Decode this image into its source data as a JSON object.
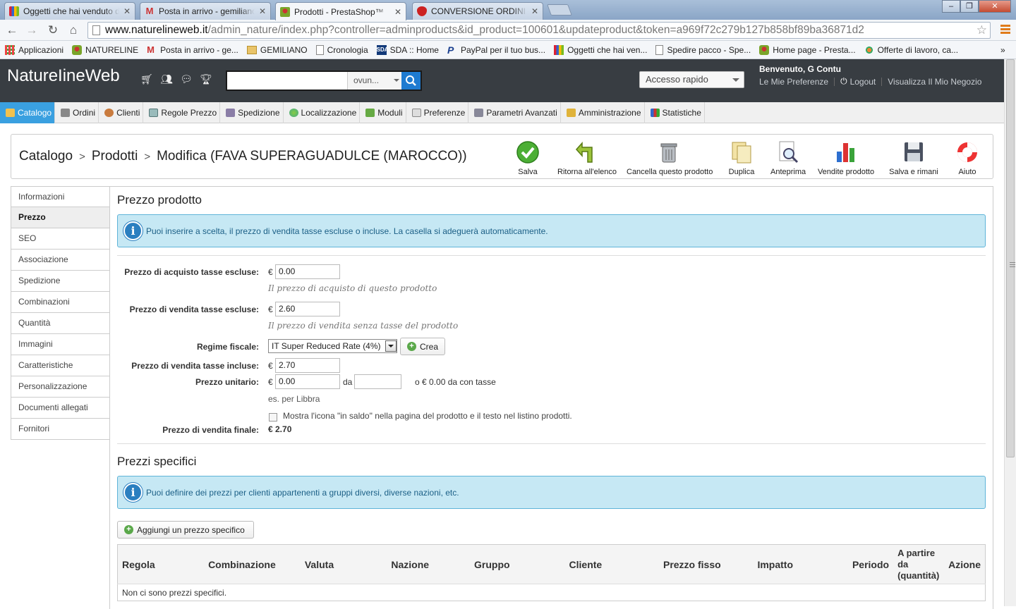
{
  "browser": {
    "tabs": [
      {
        "title": "Oggetti che hai venduto d",
        "icon": "ebay-icon",
        "color": "#d23"
      },
      {
        "title": "Posta in arrivo - gemiliano",
        "icon": "gmail-icon",
        "color": "#c33"
      },
      {
        "title": "Prodotti - PrestaShop™",
        "icon": "prestashop-icon",
        "color": "#7aa52a"
      },
      {
        "title": "CONVERSIONE ORDINI DA",
        "icon": "strawberry-icon",
        "color": "#c22"
      }
    ],
    "url_domain": "www.naturelineweb.it",
    "url_path": "/admin_nature/index.php?controller=adminproducts&id_product=100601&updateproduct&token=a969f72c279b127b858bf89ba36871d2",
    "bookmarks": [
      {
        "label": "Applicazioni",
        "icon": "apps-icon"
      },
      {
        "label": "NATURELINE",
        "icon": "prestashop-icon"
      },
      {
        "label": "Posta in arrivo - ge...",
        "icon": "gmail-icon"
      },
      {
        "label": "GEMILIANO",
        "icon": "folder-icon"
      },
      {
        "label": "Cronologia",
        "icon": "page-icon"
      },
      {
        "label": "SDA :: Home",
        "icon": "sda-icon"
      },
      {
        "label": "PayPal per il tuo bus...",
        "icon": "paypal-icon"
      },
      {
        "label": "Oggetti che hai ven...",
        "icon": "ebay-icon"
      },
      {
        "label": "Spedire pacco - Spe...",
        "icon": "page-icon"
      },
      {
        "label": "Home page - Presta...",
        "icon": "prestashop-icon"
      },
      {
        "label": "Offerte di lavoro, ca...",
        "icon": "jobs-icon"
      }
    ],
    "more": "»"
  },
  "header": {
    "brand": "NatureIineWeb",
    "search_placeholder": "",
    "search_scope": "ovun...",
    "quick_access": "Accesso rapido",
    "welcome": "Benvenuto, G Contu",
    "preferences": "Le Mie Preferenze",
    "logout": "Logout",
    "view_shop": "Visualizza Il Mio Negozio"
  },
  "menu": [
    {
      "label": "Catalogo",
      "icon": "folder-icon",
      "active": true
    },
    {
      "label": "Ordini",
      "icon": "cart-icon"
    },
    {
      "label": "Clienti",
      "icon": "user-icon"
    },
    {
      "label": "Regole Prezzo",
      "icon": "price-rule-icon"
    },
    {
      "label": "Spedizione",
      "icon": "truck-icon"
    },
    {
      "label": "Localizzazione",
      "icon": "globe-icon"
    },
    {
      "label": "Moduli",
      "icon": "puzzle-icon"
    },
    {
      "label": "Preferenze",
      "icon": "preferences-icon"
    },
    {
      "label": "Parametri Avanzati",
      "icon": "wrench-icon"
    },
    {
      "label": "Amministrazione",
      "icon": "key-icon"
    },
    {
      "label": "Statistiche",
      "icon": "chart-icon"
    }
  ],
  "breadcrumb": {
    "catalog": "Catalogo",
    "products": "Prodotti",
    "current": "Modifica (FAVA SUPERAGUADULCE (MAROCCO))"
  },
  "toolbar": [
    {
      "label": "Salva",
      "icon": "save-check-icon"
    },
    {
      "label": "Ritorna all'elenco",
      "icon": "back-arrow-icon"
    },
    {
      "label": "Cancella questo prodotto",
      "icon": "trash-icon"
    },
    {
      "label": "Duplica",
      "icon": "duplicate-icon"
    },
    {
      "label": "Anteprima",
      "icon": "preview-icon"
    },
    {
      "label": "Vendite prodotto",
      "icon": "sales-chart-icon"
    },
    {
      "label": "Salva e rimani",
      "icon": "floppy-icon"
    },
    {
      "label": "Aiuto",
      "icon": "lifebuoy-icon"
    }
  ],
  "sidetabs": [
    {
      "label": "Informazioni"
    },
    {
      "label": "Prezzo",
      "active": true
    },
    {
      "label": "SEO"
    },
    {
      "label": "Associazione"
    },
    {
      "label": "Spedizione"
    },
    {
      "label": "Combinazioni"
    },
    {
      "label": "Quantità"
    },
    {
      "label": "Immagini"
    },
    {
      "label": "Caratteristiche"
    },
    {
      "label": "Personalizzazione"
    },
    {
      "label": "Documenti allegati"
    },
    {
      "label": "Fornitori"
    }
  ],
  "price": {
    "title": "Prezzo prodotto",
    "info": "Puoi inserire a scelta, il prezzo di vendita tasse escluse o incluse. La casella si adeguerà automaticamente.",
    "currency": "€",
    "wholesale_label": "Prezzo di acquisto tasse escluse:",
    "wholesale_value": "0.00",
    "wholesale_hint": "Il prezzo di acquisto di questo prodotto",
    "sale_label": "Prezzo di vendita tasse escluse:",
    "sale_value": "2.60",
    "sale_hint": "Il prezzo di vendita senza tasse del prodotto",
    "tax_label": "Regime fiscale:",
    "tax_value": "IT Super Reduced Rate (4%)",
    "create": "Crea",
    "incl_label": "Prezzo di vendita tasse incluse:",
    "incl_value": "2.70",
    "unit_label": "Prezzo unitario:",
    "unit_value": "0.00",
    "unit_da": "da",
    "unit_per_value": "",
    "unit_taxed": "o € 0.00 da con tasse",
    "unit_example": "es. per Libbra",
    "on_sale": "Mostra l'icona \"in saldo\" nella pagina del prodotto e il testo nel listino prodotti.",
    "final_label": "Prezzo di vendita finale:",
    "final_value": "€ 2.70"
  },
  "specific": {
    "title": "Prezzi specifici",
    "info": "Puoi definire dei prezzi per clienti appartenenti a gruppi diversi, diverse nazioni, etc.",
    "add": "Aggiungi un prezzo specifico",
    "columns": [
      "Regola",
      "Combinazione",
      "Valuta",
      "Nazione",
      "Gruppo",
      "Cliente",
      "Prezzo fisso",
      "Impatto",
      "Periodo",
      "A partire da (quantità)",
      "Azione"
    ],
    "empty": "Non ci sono prezzi specifici."
  }
}
